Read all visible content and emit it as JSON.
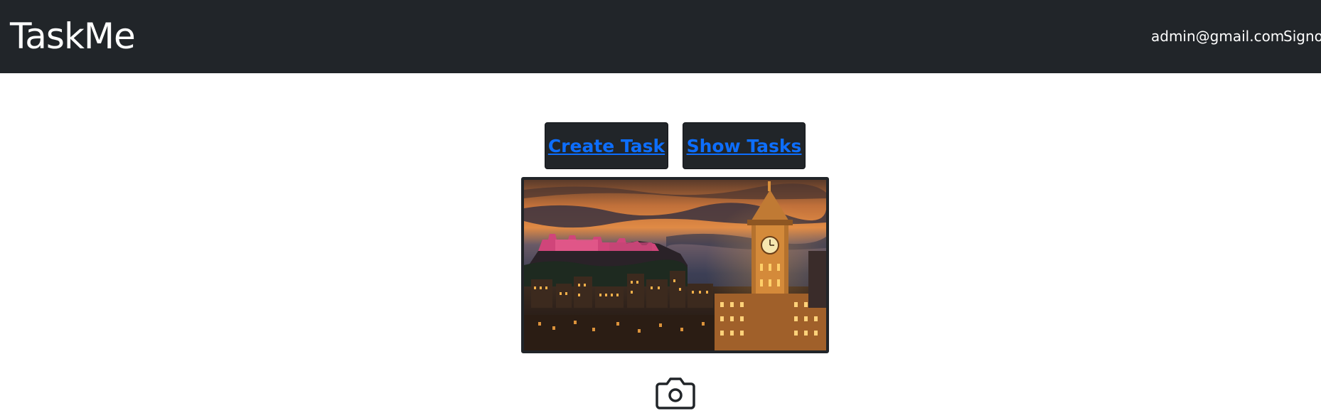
{
  "navbar": {
    "brand": "TaskMe",
    "user_email": "admin@gmail.com",
    "signout_label": "Signout"
  },
  "actions": {
    "create_label": "Create Task",
    "show_label": "Show Tasks"
  },
  "hero_image": {
    "alt": "Edinburgh skyline at dusk with castle and clock tower"
  },
  "icons": {
    "upload": "camera-icon"
  },
  "colors": {
    "navbar_bg": "#212529",
    "link": "#0d6efd",
    "page_bg": "#ffffff"
  }
}
